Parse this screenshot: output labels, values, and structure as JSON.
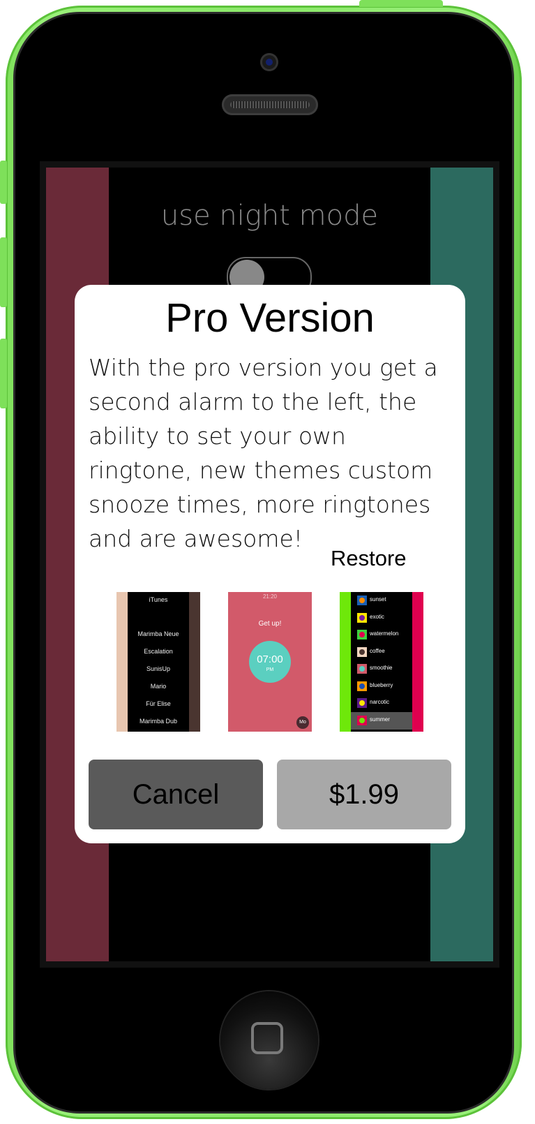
{
  "screen": {
    "night_mode_label": "use night mode",
    "night_mode_on": false
  },
  "dialog": {
    "title": "Pro Version",
    "body": "With the pro version you get a second alarm to the left, the ability to set your own ringtone, new themes custom snooze times, more ringtones and are awesome!",
    "restore_label": "Restore",
    "cancel_label": "Cancel",
    "price_label": "$1.99"
  },
  "preview_ringtones": {
    "items": [
      "iTunes",
      "Marimba Neue",
      "Escalation",
      "SunisUp",
      "Mario",
      "Für Elise",
      "Marimba Dub"
    ]
  },
  "preview_alarm": {
    "time_top": "21:20",
    "message": "Get up!",
    "clock_time": "07:00",
    "period": "PM",
    "day": "Mo"
  },
  "preview_themes": {
    "items": [
      {
        "name": "sunset",
        "swatch": "#1a5fb4",
        "dot": "#ff8c00"
      },
      {
        "name": "exotic",
        "swatch": "#ffe600",
        "dot": "#7a1fa2"
      },
      {
        "name": "watermelon",
        "swatch": "#3dd23d",
        "dot": "#e0004f"
      },
      {
        "name": "coffee",
        "swatch": "#f2d6c0",
        "dot": "#4a3530"
      },
      {
        "name": "smoothie",
        "swatch": "#d25a6a",
        "dot": "#5bcfc0"
      },
      {
        "name": "blueberry",
        "swatch": "#ff9a00",
        "dot": "#1a4fb4"
      },
      {
        "name": "narcotic",
        "swatch": "#5a1a8a",
        "dot": "#ffe600"
      },
      {
        "name": "summer",
        "swatch": "#e0004f",
        "dot": "#6ee80a"
      }
    ],
    "selected": "summer"
  },
  "colors": {
    "phone_body": "#8be869",
    "left_panel": "#6a2a38",
    "right_panel": "#2c6a5f",
    "cancel_button": "#5a5a5a",
    "buy_button": "#a8a8a8"
  }
}
